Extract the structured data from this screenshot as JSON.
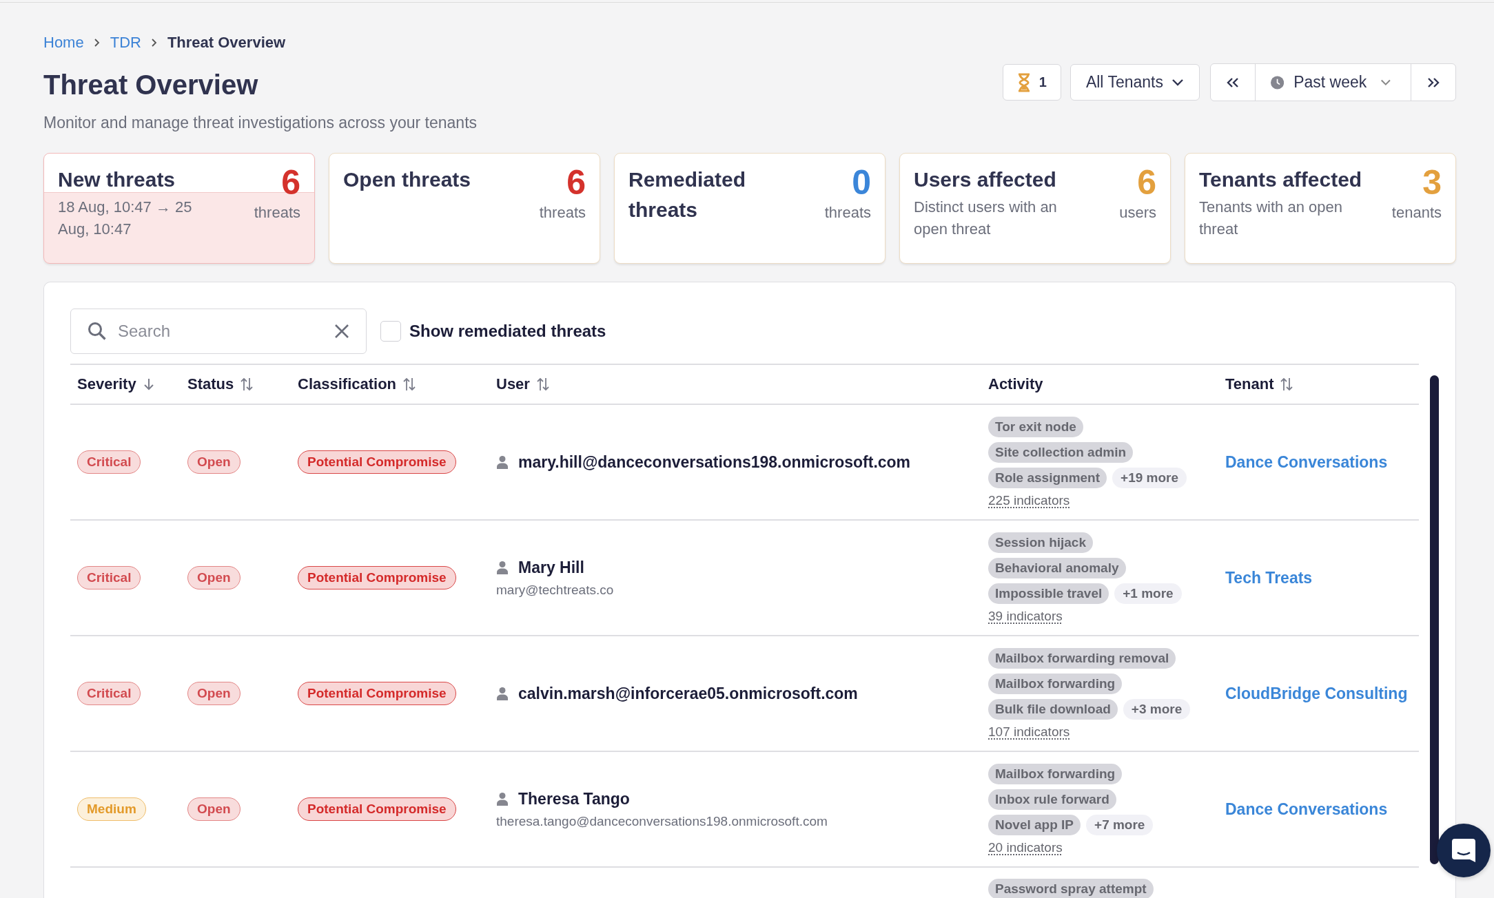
{
  "breadcrumb": [
    {
      "label": "Home",
      "kind": "link"
    },
    {
      "label": "TDR",
      "kind": "link"
    },
    {
      "label": "Threat Overview",
      "kind": "current"
    }
  ],
  "title": "Threat Overview",
  "subtitle": "Monitor and manage threat investigations across your tenants",
  "toolbar": {
    "pending_count": "1",
    "tenant_filter": "All Tenants",
    "period": "Past week"
  },
  "stat_cards": [
    {
      "title": "New threats",
      "value": "6",
      "unit": "threats",
      "description": "18 Aug, 10:47 → 25 Aug, 10:47",
      "selected": true,
      "color": "#d4322c"
    },
    {
      "title": "Open threats",
      "value": "6",
      "unit": "threats",
      "selected": false,
      "color": "#d4322c"
    },
    {
      "title": "Remediated threats",
      "value": "0",
      "unit": "threats",
      "selected": false,
      "color": "#3b86d9"
    },
    {
      "title": "Users affected",
      "value": "6",
      "unit": "users",
      "description": "Distinct users with an open threat",
      "selected": false,
      "color": "#e3a03e"
    },
    {
      "title": "Tenants affected",
      "value": "3",
      "unit": "tenants",
      "description": "Tenants with an open threat",
      "selected": false,
      "color": "#e3a03e"
    }
  ],
  "search": {
    "placeholder": "Search"
  },
  "show_remediated": {
    "label": "Show remediated threats",
    "checked": false
  },
  "table": {
    "columns": [
      {
        "label": "Severity",
        "kind": "sorted"
      },
      {
        "label": "Status",
        "kind": "sortable"
      },
      {
        "label": "Classification",
        "kind": "sortable"
      },
      {
        "label": "User",
        "kind": "sortable"
      },
      {
        "label": "Activity",
        "kind": "plain"
      },
      {
        "label": "Tenant",
        "kind": "sortable"
      }
    ],
    "rows": [
      {
        "severity": {
          "label": "Critical",
          "kind": "critical"
        },
        "status": "Open",
        "classification": "Potential Compromise",
        "user": {
          "name": "mary.hill@danceconversations198.onmicrosoft.com"
        },
        "activity": {
          "tags": [
            "Tor exit node",
            "Site collection admin",
            "Role assignment"
          ],
          "more": "+19 more",
          "indicators": "225 indicators"
        },
        "tenant": "Dance Conversations"
      },
      {
        "severity": {
          "label": "Critical",
          "kind": "critical"
        },
        "status": "Open",
        "classification": "Potential Compromise",
        "user": {
          "name": "Mary Hill",
          "email": "mary@techtreats.co"
        },
        "activity": {
          "tags": [
            "Session hijack",
            "Behavioral anomaly",
            "Impossible travel"
          ],
          "more": "+1 more",
          "indicators": "39 indicators"
        },
        "tenant": "Tech Treats"
      },
      {
        "severity": {
          "label": "Critical",
          "kind": "critical"
        },
        "status": "Open",
        "classification": "Potential Compromise",
        "user": {
          "name": "calvin.marsh@inforcerae05.onmicrosoft.com"
        },
        "activity": {
          "tags": [
            "Mailbox forwarding removal",
            "Mailbox forwarding",
            "Bulk file download"
          ],
          "more": "+3 more",
          "indicators": "107 indicators"
        },
        "tenant": "CloudBridge Consulting"
      },
      {
        "severity": {
          "label": "Medium",
          "kind": "medium"
        },
        "status": "Open",
        "classification": "Potential Compromise",
        "user": {
          "name": "Theresa Tango",
          "email": "theresa.tango@danceconversations198.onmicrosoft.com"
        },
        "activity": {
          "tags": [
            "Mailbox forwarding",
            "Inbox rule forward",
            "Novel app IP"
          ],
          "more": "+7 more",
          "indicators": "20 indicators"
        },
        "tenant": "Dance Conversations"
      },
      {
        "activity": {
          "tags": [
            "Password spray attempt"
          ]
        }
      }
    ]
  }
}
